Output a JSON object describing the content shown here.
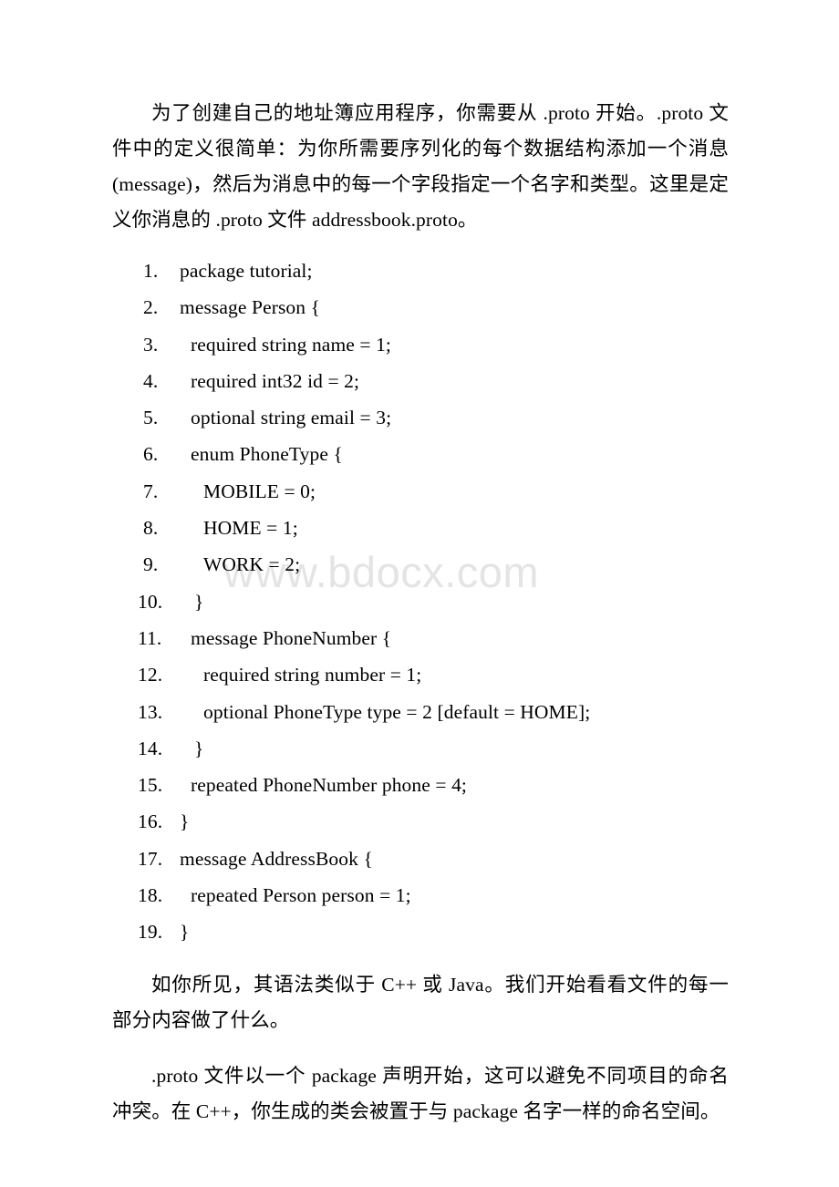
{
  "document": {
    "watermark": "www.bdocx.com",
    "background_color": "#ffffff",
    "text_color": "#000000",
    "watermark_color": "#e4e4e4"
  },
  "paragraphs": {
    "intro": "为了创建自己的地址簿应用程序，你需要从 .proto 开始。.proto 文件中的定义很简单：为你所需要序列化的每个数据结构添加一个消息(message)，然后为消息中的每一个字段指定一个名字和类型。这里是定义你消息的 .proto 文件 addressbook.proto。",
    "after_1": "如你所见，其语法类似于 C++ 或 Java。我们开始看看文件的每一部分内容做了什么。",
    "after_2": ".proto 文件以一个 package 声明开始，这可以避免不同项目的命名冲突。在 C++，你生成的类会被置于与 package 名字一样的命名空间。"
  },
  "code_listing": {
    "lines": [
      {
        "num": "1.",
        "text": "package tutorial;",
        "indent": 0
      },
      {
        "num": "2.",
        "text": "message Person {",
        "indent": 0
      },
      {
        "num": "3.",
        "text": "required string name = 1;",
        "indent": 1
      },
      {
        "num": "4.",
        "text": "required int32 id = 2;",
        "indent": 1
      },
      {
        "num": "5.",
        "text": "optional string email = 3;",
        "indent": 1
      },
      {
        "num": "6.",
        "text": "enum PhoneType {",
        "indent": 1
      },
      {
        "num": "7.",
        "text": "MOBILE = 0;",
        "indent": 2
      },
      {
        "num": "8.",
        "text": "HOME = 1;",
        "indent": 2
      },
      {
        "num": "9.",
        "text": "WORK = 2;",
        "indent": 2
      },
      {
        "num": "10.",
        "text": "}",
        "indent": 1.5
      },
      {
        "num": "11.",
        "text": "message PhoneNumber {",
        "indent": 1
      },
      {
        "num": "12.",
        "text": "required string number = 1;",
        "indent": 2
      },
      {
        "num": "13.",
        "text": "optional PhoneType type = 2 [default = HOME];",
        "indent": 2
      },
      {
        "num": "14.",
        "text": "}",
        "indent": 1.5
      },
      {
        "num": "15.",
        "text": "repeated PhoneNumber phone = 4;",
        "indent": 1
      },
      {
        "num": "16.",
        "text": "}",
        "indent": 0
      },
      {
        "num": "17.",
        "text": "message AddressBook {",
        "indent": 0
      },
      {
        "num": "18.",
        "text": "repeated Person person = 1;",
        "indent": 1
      },
      {
        "num": "19.",
        "text": "}",
        "indent": 0
      }
    ]
  }
}
